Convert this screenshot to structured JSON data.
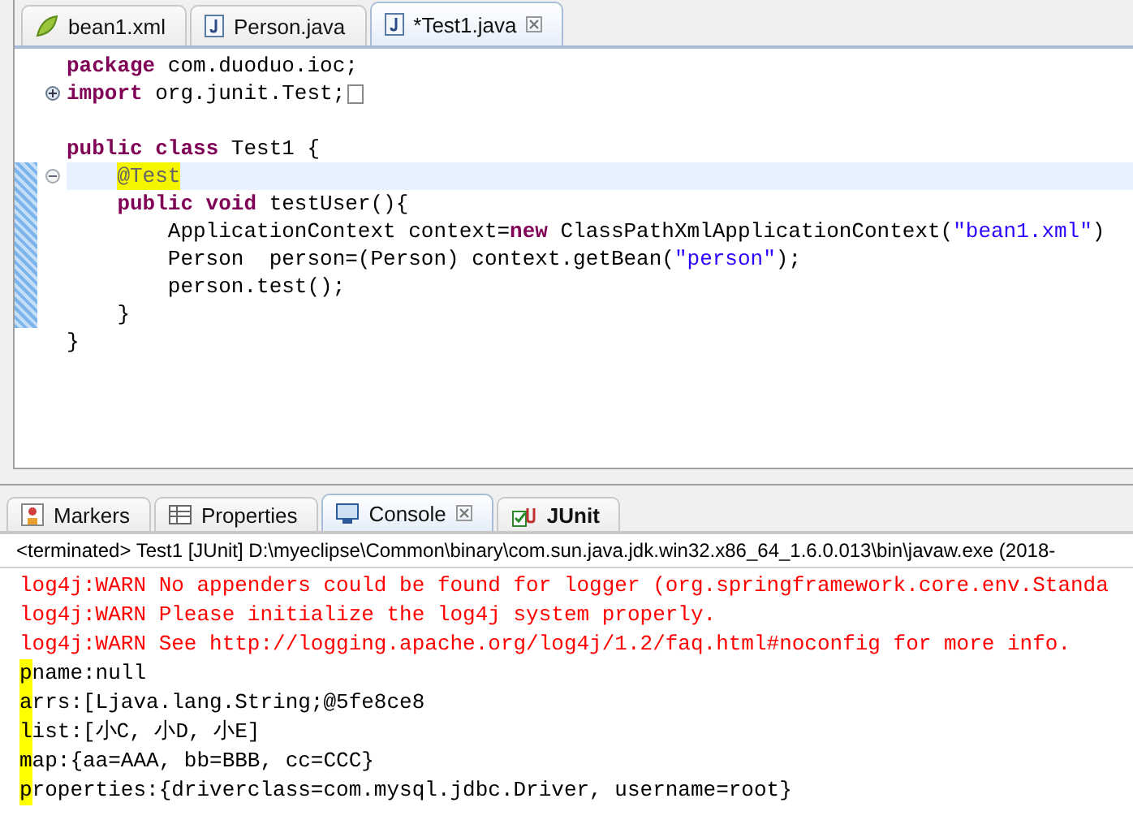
{
  "editor": {
    "tabs": [
      {
        "label": "bean1.xml",
        "kind": "xml",
        "selected": false,
        "closable": false
      },
      {
        "label": "Person.java",
        "kind": "java",
        "selected": false,
        "closable": false
      },
      {
        "label": "*Test1.java",
        "kind": "java",
        "selected": true,
        "closable": true
      }
    ],
    "lines": [
      {
        "foldable": false,
        "changed": false,
        "current": false,
        "tokens": [
          {
            "kind": "keyword",
            "text": "package"
          },
          {
            "kind": "plain",
            "text": " com.duoduo.ioc;"
          }
        ]
      },
      {
        "foldable": true,
        "folded": true,
        "changed": false,
        "current": false,
        "tokens": [
          {
            "kind": "keyword",
            "text": "import"
          },
          {
            "kind": "plain",
            "text": " org.junit.Test;"
          }
        ]
      },
      {
        "foldable": false,
        "changed": false,
        "current": false
      },
      {
        "foldable": false,
        "changed": false,
        "current": false,
        "tokens": [
          {
            "kind": "keyword",
            "text": "public class"
          },
          {
            "kind": "plain",
            "text": " Test1 {"
          }
        ],
        "children": [
          {
            "foldable": true,
            "folded": false,
            "changed": true,
            "current": true,
            "tokens": [
              {
                "kind": "annotation",
                "text": "@Test",
                "highlighted": true
              }
            ]
          },
          {
            "foldable": false,
            "changed": true,
            "current": false,
            "tokens": [
              {
                "kind": "keyword",
                "text": "public void"
              },
              {
                "kind": "plain",
                "text": " testUser(){"
              }
            ],
            "children": [
              {
                "foldable": false,
                "changed": true,
                "current": false,
                "tokens": [
                  {
                    "kind": "plain",
                    "text": "ApplicationContext context="
                  },
                  {
                    "kind": "keyword",
                    "text": "new"
                  },
                  {
                    "kind": "plain",
                    "text": " ClassPathXmlApplicationContext("
                  },
                  {
                    "kind": "string",
                    "text": "\"bean1.xml\""
                  },
                  {
                    "kind": "plain",
                    "text": ")"
                  }
                ]
              },
              {
                "foldable": false,
                "changed": true,
                "current": false,
                "tokens": [
                  {
                    "kind": "plain",
                    "text": "Person  person=(Person) context.getBean("
                  },
                  {
                    "kind": "string",
                    "text": "\"person\""
                  },
                  {
                    "kind": "plain",
                    "text": ");"
                  }
                ]
              },
              {
                "foldable": false,
                "changed": true,
                "current": false,
                "tokens": [
                  {
                    "kind": "plain",
                    "text": "person.test();"
                  }
                ]
              }
            ]
          },
          {
            "foldable": false,
            "changed": true,
            "current": false,
            "tokens": [
              {
                "kind": "plain",
                "text": "}"
              }
            ]
          }
        ]
      },
      {
        "foldable": false,
        "changed": false,
        "current": false,
        "tokens": [
          {
            "kind": "plain",
            "text": "}"
          }
        ]
      }
    ]
  },
  "console": {
    "tabs": [
      {
        "label": "Markers",
        "kind": "markers",
        "selected": false,
        "closable": false
      },
      {
        "label": "Properties",
        "kind": "properties",
        "selected": false,
        "closable": false
      },
      {
        "label": "Console",
        "kind": "console",
        "selected": true,
        "closable": true
      },
      {
        "label": "JUnit",
        "kind": "junit",
        "selected": false,
        "closable": false
      }
    ],
    "header": "<terminated> Test1 [JUnit] D:\\myeclipse\\Common\\binary\\com.sun.java.jdk.win32.x86_64_1.6.0.013\\bin\\javaw.exe (2018-",
    "lines": [
      {
        "kind": "stderr",
        "highlighted": false,
        "text": "log4j:WARN No appenders could be found for logger (org.springframework.core.env.Standa"
      },
      {
        "kind": "stderr",
        "highlighted": false,
        "text": "log4j:WARN Please initialize the log4j system properly."
      },
      {
        "kind": "stderr",
        "highlighted": false,
        "text": "log4j:WARN See http://logging.apache.org/log4j/1.2/faq.html#noconfig for more info."
      },
      {
        "kind": "stdout",
        "highlighted": true,
        "text": "pname:null"
      },
      {
        "kind": "stdout",
        "highlighted": true,
        "text": "arrs:[Ljava.lang.String;@5fe8ce8"
      },
      {
        "kind": "stdout",
        "highlighted": true,
        "text": "list:[小C, 小D, 小E]"
      },
      {
        "kind": "stdout",
        "highlighted": true,
        "text": "map:{aa=AAA, bb=BBB, cc=CCC}"
      },
      {
        "kind": "stdout",
        "highlighted": true,
        "text": "properties:{driverclass=com.mysql.jdbc.Driver, username=root}"
      }
    ]
  }
}
